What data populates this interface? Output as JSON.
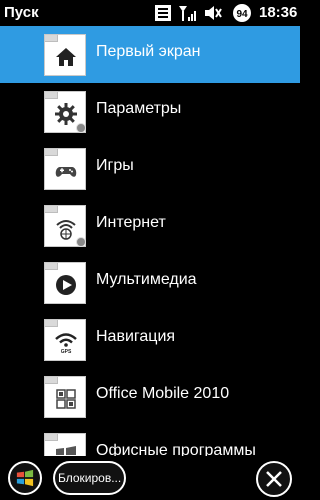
{
  "statusbar": {
    "title": "Пуск",
    "time": "18:36",
    "battery": "94",
    "icons": [
      "notification-icon",
      "signal-icon",
      "volume-icon",
      "battery-icon"
    ]
  },
  "menu": {
    "items": [
      {
        "label": "Первый экран",
        "icon": "home-icon",
        "selected": true
      },
      {
        "label": "Параметры",
        "icon": "settings-gear-icon",
        "selected": false
      },
      {
        "label": "Игры",
        "icon": "gamepad-icon",
        "selected": false
      },
      {
        "label": "Интернет",
        "icon": "internet-icon",
        "selected": false
      },
      {
        "label": "Мультимедиа",
        "icon": "play-icon",
        "selected": false
      },
      {
        "label": "Навигация",
        "icon": "gps-icon",
        "selected": false
      },
      {
        "label": "Office Mobile 2010",
        "icon": "office-icon",
        "selected": false
      },
      {
        "label": "Офисные программы",
        "icon": "windows-flag-icon",
        "selected": false
      }
    ]
  },
  "softbar": {
    "start_icon": "windows-start-icon",
    "lock_label": "Блокиров...",
    "close_icon": "close-icon"
  },
  "colors": {
    "selection": "#2f9be2",
    "background": "#000000",
    "text": "#ffffff"
  }
}
